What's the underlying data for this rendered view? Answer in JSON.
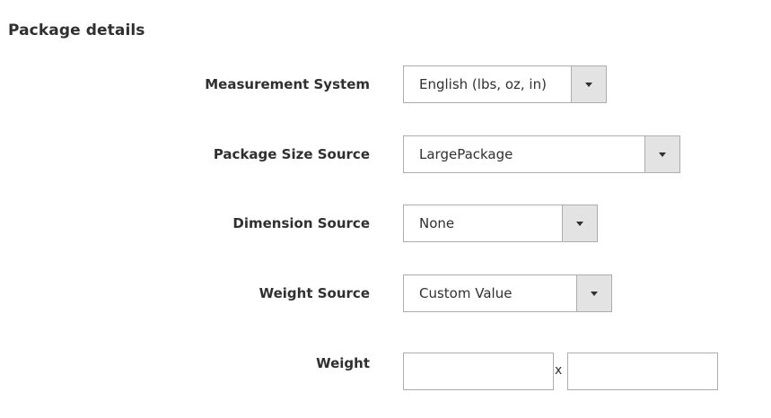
{
  "section": {
    "title": "Package details"
  },
  "fields": {
    "measurement_system": {
      "label": "Measurement System",
      "value": "English (lbs, oz, in)"
    },
    "package_size_source": {
      "label": "Package Size Source",
      "value": "LargePackage"
    },
    "dimension_source": {
      "label": "Dimension Source",
      "value": "None"
    },
    "weight_source": {
      "label": "Weight Source",
      "value": "Custom Value"
    },
    "weight": {
      "label": "Weight",
      "separator": "x",
      "value_1": "",
      "value_2": ""
    }
  },
  "icons": {
    "select_arrow": "triangle-down-icon"
  },
  "colors": {
    "text": "#303030",
    "border": "#adadad",
    "arrow_bg": "#e3e3e3"
  }
}
